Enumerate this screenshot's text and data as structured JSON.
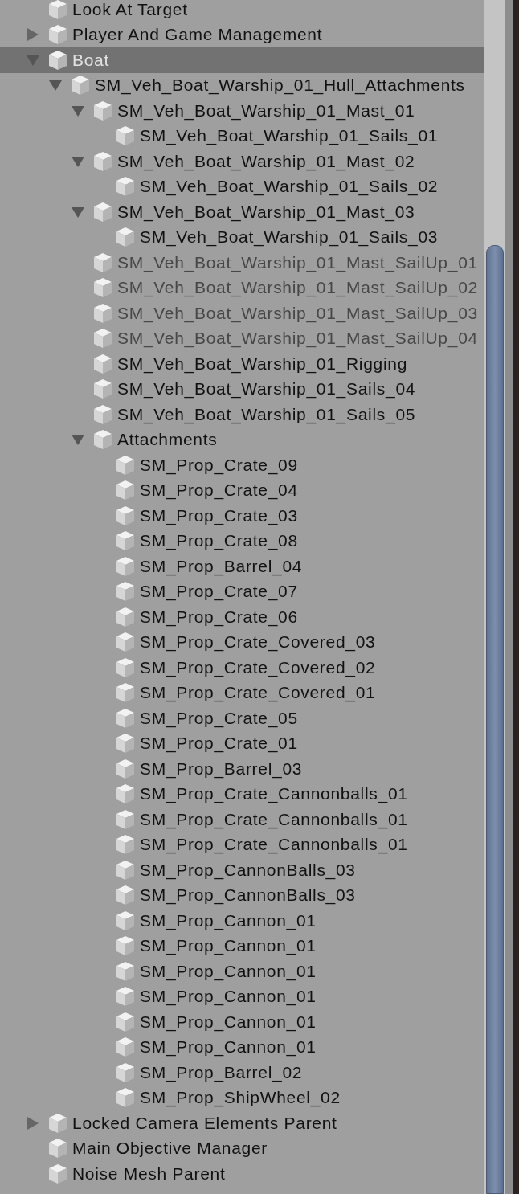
{
  "tree": [
    {
      "name": "Look At Target",
      "selected": false,
      "active": true
    },
    {
      "name": "Player And Game Management",
      "expanded": false,
      "selected": false,
      "active": true
    },
    {
      "name": "Boat",
      "expanded": true,
      "selected": true,
      "active": true,
      "children": [
        {
          "name": "SM_Veh_Boat_Warship_01_Hull_Attachments",
          "expanded": true,
          "selected": false,
          "active": true,
          "children": [
            {
              "name": "SM_Veh_Boat_Warship_01_Mast_01",
              "expanded": true,
              "selected": false,
              "active": true,
              "children": [
                {
                  "name": "SM_Veh_Boat_Warship_01_Sails_01",
                  "selected": false,
                  "active": true
                }
              ]
            },
            {
              "name": "SM_Veh_Boat_Warship_01_Mast_02",
              "expanded": true,
              "selected": false,
              "active": true,
              "children": [
                {
                  "name": "SM_Veh_Boat_Warship_01_Sails_02",
                  "selected": false,
                  "active": true
                }
              ]
            },
            {
              "name": "SM_Veh_Boat_Warship_01_Mast_03",
              "expanded": true,
              "selected": false,
              "active": true,
              "children": [
                {
                  "name": "SM_Veh_Boat_Warship_01_Sails_03",
                  "selected": false,
                  "active": true
                }
              ]
            },
            {
              "name": "SM_Veh_Boat_Warship_01_Mast_SailUp_01",
              "selected": false,
              "active": false
            },
            {
              "name": "SM_Veh_Boat_Warship_01_Mast_SailUp_02",
              "selected": false,
              "active": false
            },
            {
              "name": "SM_Veh_Boat_Warship_01_Mast_SailUp_03",
              "selected": false,
              "active": false
            },
            {
              "name": "SM_Veh_Boat_Warship_01_Mast_SailUp_04",
              "selected": false,
              "active": false
            },
            {
              "name": "SM_Veh_Boat_Warship_01_Rigging",
              "selected": false,
              "active": true
            },
            {
              "name": "SM_Veh_Boat_Warship_01_Sails_04",
              "selected": false,
              "active": true
            },
            {
              "name": "SM_Veh_Boat_Warship_01_Sails_05",
              "selected": false,
              "active": true
            },
            {
              "name": "Attachments",
              "expanded": true,
              "selected": false,
              "active": true,
              "children": [
                {
                  "name": "SM_Prop_Crate_09",
                  "selected": false,
                  "active": true
                },
                {
                  "name": "SM_Prop_Crate_04",
                  "selected": false,
                  "active": true
                },
                {
                  "name": "SM_Prop_Crate_03",
                  "selected": false,
                  "active": true
                },
                {
                  "name": "SM_Prop_Crate_08",
                  "selected": false,
                  "active": true
                },
                {
                  "name": "SM_Prop_Barrel_04",
                  "selected": false,
                  "active": true
                },
                {
                  "name": "SM_Prop_Crate_07",
                  "selected": false,
                  "active": true
                },
                {
                  "name": "SM_Prop_Crate_06",
                  "selected": false,
                  "active": true
                },
                {
                  "name": "SM_Prop_Crate_Covered_03",
                  "selected": false,
                  "active": true
                },
                {
                  "name": "SM_Prop_Crate_Covered_02",
                  "selected": false,
                  "active": true
                },
                {
                  "name": "SM_Prop_Crate_Covered_01",
                  "selected": false,
                  "active": true
                },
                {
                  "name": "SM_Prop_Crate_05",
                  "selected": false,
                  "active": true
                },
                {
                  "name": "SM_Prop_Crate_01",
                  "selected": false,
                  "active": true
                },
                {
                  "name": "SM_Prop_Barrel_03",
                  "selected": false,
                  "active": true
                },
                {
                  "name": "SM_Prop_Crate_Cannonballs_01",
                  "selected": false,
                  "active": true
                },
                {
                  "name": "SM_Prop_Crate_Cannonballs_01",
                  "selected": false,
                  "active": true
                },
                {
                  "name": "SM_Prop_Crate_Cannonballs_01",
                  "selected": false,
                  "active": true
                },
                {
                  "name": "SM_Prop_CannonBalls_03",
                  "selected": false,
                  "active": true
                },
                {
                  "name": "SM_Prop_CannonBalls_03",
                  "selected": false,
                  "active": true
                },
                {
                  "name": "SM_Prop_Cannon_01",
                  "selected": false,
                  "active": true
                },
                {
                  "name": "SM_Prop_Cannon_01",
                  "selected": false,
                  "active": true
                },
                {
                  "name": "SM_Prop_Cannon_01",
                  "selected": false,
                  "active": true
                },
                {
                  "name": "SM_Prop_Cannon_01",
                  "selected": false,
                  "active": true
                },
                {
                  "name": "SM_Prop_Cannon_01",
                  "selected": false,
                  "active": true
                },
                {
                  "name": "SM_Prop_Cannon_01",
                  "selected": false,
                  "active": true
                },
                {
                  "name": "SM_Prop_Barrel_02",
                  "selected": false,
                  "active": true
                },
                {
                  "name": "SM_Prop_ShipWheel_02",
                  "selected": false,
                  "active": true
                }
              ]
            }
          ]
        }
      ]
    },
    {
      "name": "Locked Camera Elements Parent",
      "expanded": false,
      "selected": false,
      "active": true
    },
    {
      "name": "Main Objective Manager",
      "selected": false,
      "active": true
    },
    {
      "name": "Noise Mesh Parent",
      "selected": false,
      "active": true
    }
  ]
}
